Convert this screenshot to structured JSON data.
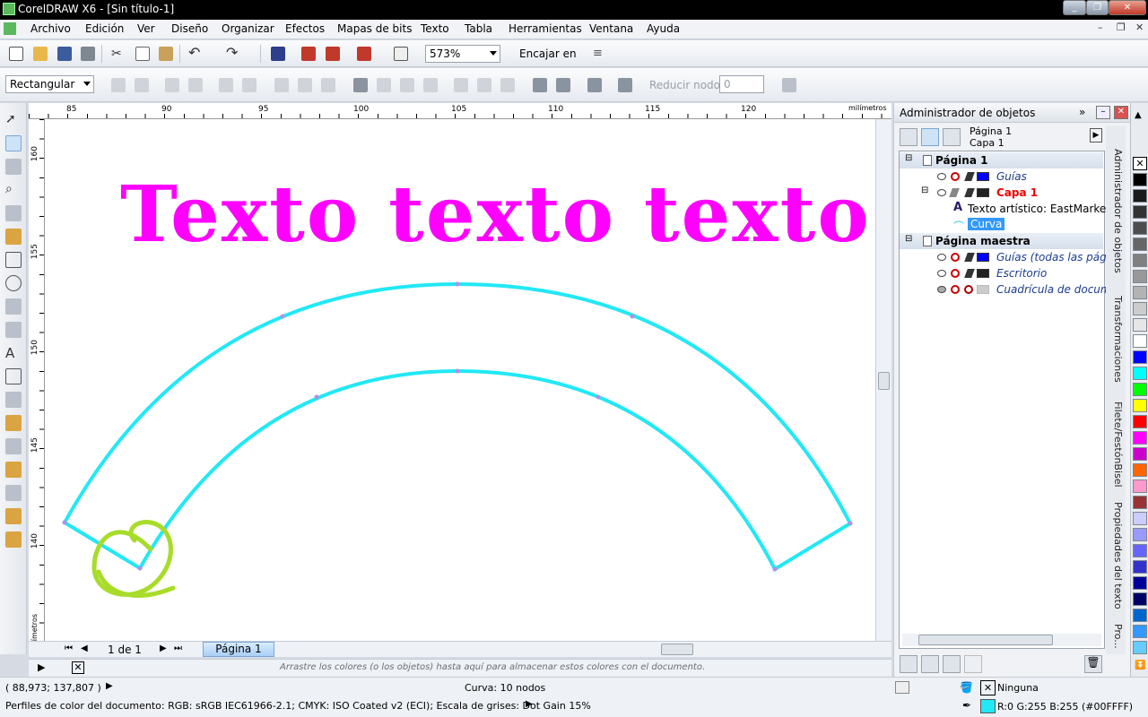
{
  "window": {
    "title": "CorelDRAW X6 - [Sin título-1]"
  },
  "menu": [
    "Archivo",
    "Edición",
    "Ver",
    "Diseño",
    "Organizar",
    "Efectos",
    "Mapas de bits",
    "Texto",
    "Tabla",
    "Herramientas",
    "Ventana",
    "Ayuda"
  ],
  "toolbar": {
    "zoom": "573%",
    "snap_label": "Encajar en"
  },
  "propbar": {
    "shape_mode": "Rectangular",
    "reduce_nodes_label": "Reducir nodos",
    "reduce_nodes_value": "0"
  },
  "ruler": {
    "unit_top": "milímetros",
    "unit_left": "milímetros",
    "top_ticks": [
      "85",
      "90",
      "95",
      "100",
      "105",
      "110",
      "115",
      "120"
    ],
    "left_ticks": [
      "160",
      "155",
      "150",
      "145",
      "140"
    ]
  },
  "canvas": {
    "artistic_text": "Texto texto texto",
    "text_color": "#ff00ff",
    "curve_color": "#22e8f5",
    "annotation_color": "#a8dc2a"
  },
  "pages": {
    "counter": "1 de 1",
    "tab": "Página 1"
  },
  "palette_hint": "Arrastre los colores (o los objetos) hasta aquí para almacenar estos colores con el documento.",
  "object_manager": {
    "title": "Administrador de objetos",
    "current_page": "Página 1",
    "current_layer": "Capa 1",
    "tree": {
      "page1": "Página 1",
      "guides": "Guías",
      "layer1": "Capa 1",
      "artistic_text": "Texto artístico: EastMarket (N",
      "curve": "Curva",
      "master": "Página maestra",
      "master_guides": "Guías (todas las págin",
      "desktop": "Escritorio",
      "grid": "Cuadrícula de docume"
    }
  },
  "dock_tabs": [
    "Administrador de objetos",
    "Transformaciones",
    "Filete/FestónBisel",
    "Propiedades del texto",
    "Pro..."
  ],
  "status": {
    "coords": "( 88,973; 137,807 )",
    "selection": "Curva: 10 nodos",
    "fill": "Ninguna",
    "outline_color": "R:0 G:255 B:255 (#00FFFF)",
    "color_profile": "Perfiles de color del documento: RGB: sRGB IEC61966-2.1; CMYK: ISO Coated v2 (ECI); Escala de grises: Dot Gain 15%"
  },
  "palette_colors": [
    "#000000",
    "#1a1a1a",
    "#333333",
    "#4d4d4d",
    "#666666",
    "#808080",
    "#999999",
    "#b3b3b3",
    "#cccccc",
    "#e6e6e6",
    "#ffffff",
    "#0000ff",
    "#00ffff",
    "#00ff00",
    "#ffff00",
    "#ff0000",
    "#ff00ff",
    "#cc00cc",
    "#ff6600",
    "#ff99cc",
    "#993333",
    "#ccccff",
    "#9999ff",
    "#6666ff",
    "#3333cc",
    "#000099",
    "#000066",
    "#0066cc",
    "#3399ff",
    "#66ccff"
  ]
}
